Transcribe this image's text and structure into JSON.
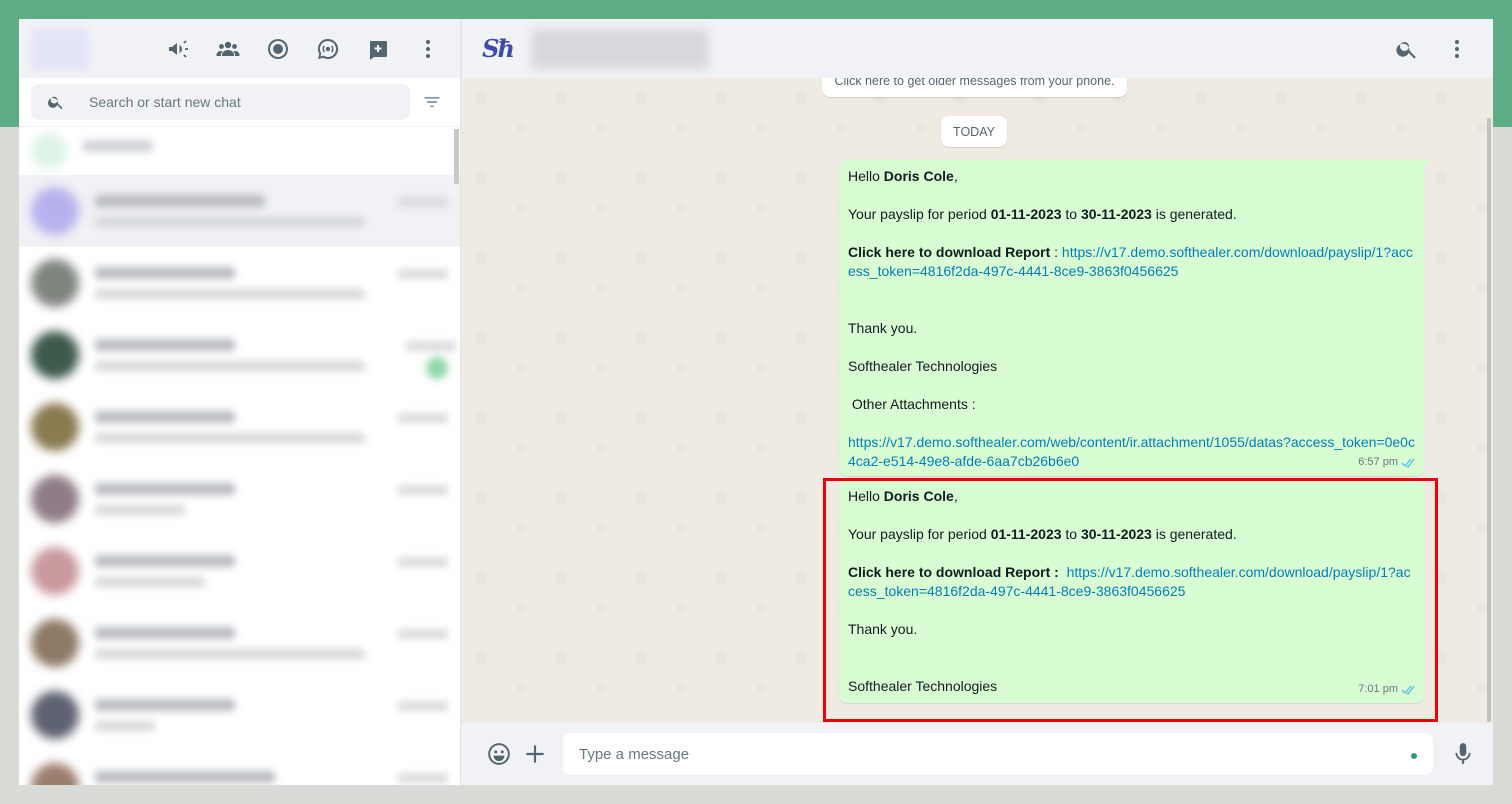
{
  "colors": {
    "band": "#5fad86",
    "bubble": "#d9fdd3",
    "link": "#027eb5",
    "highlight": "#e8000b",
    "tick": "#53bdeb"
  },
  "left": {
    "header_icons": [
      "communities-megaphone-icon",
      "communities-icon",
      "status-icon",
      "channels-icon",
      "new-chat-icon",
      "menu-icon"
    ],
    "search_placeholder": "Search or start new chat"
  },
  "conversation": {
    "logo_text": "Sħ",
    "older_note": "Click here to get older messages from your phone.",
    "date_divider": "TODAY",
    "messages": [
      {
        "greeting": "Hello ",
        "name": "Doris Cole",
        "comma": ",",
        "period_pre": "Your payslip for period ",
        "period_from": "01-11-2023",
        "period_mid": " to ",
        "period_to": "30-11-2023",
        "period_post": " is generated.",
        "download_label": "Click here to download Report",
        "download_sep": " : ",
        "download_url": "https://v17.demo.softhealer.com/download/payslip/1?access_token=4816f2da-497c-4441-8ce9-3863f0456625",
        "thanks": "Thank you.",
        "company": "Softhealer Technologies",
        "attach_label": " Other Attachments :",
        "attach_url": "https://v17.demo.softhealer.com/web/content/ir.attachment/1055/datas?access_token=0e0c4ca2-e514-49e8-afde-6aa7cb26b6e0",
        "time": "6:57 pm"
      },
      {
        "greeting": "Hello ",
        "name": "Doris Cole",
        "comma": ",",
        "period_pre": "Your payslip for period ",
        "period_from": "01-11-2023",
        "period_mid": " to ",
        "period_to": "30-11-2023",
        "period_post": " is generated.",
        "download_label": "Click here to download Report :",
        "download_url": "https://v17.demo.softhealer.com/download/payslip/1?access_token=4816f2da-497c-4441-8ce9-3863f0456625",
        "thanks": "Thank you.",
        "company": "Softhealer Technologies",
        "time": "7:01 pm"
      }
    ]
  },
  "compose": {
    "placeholder": "Type a message"
  }
}
